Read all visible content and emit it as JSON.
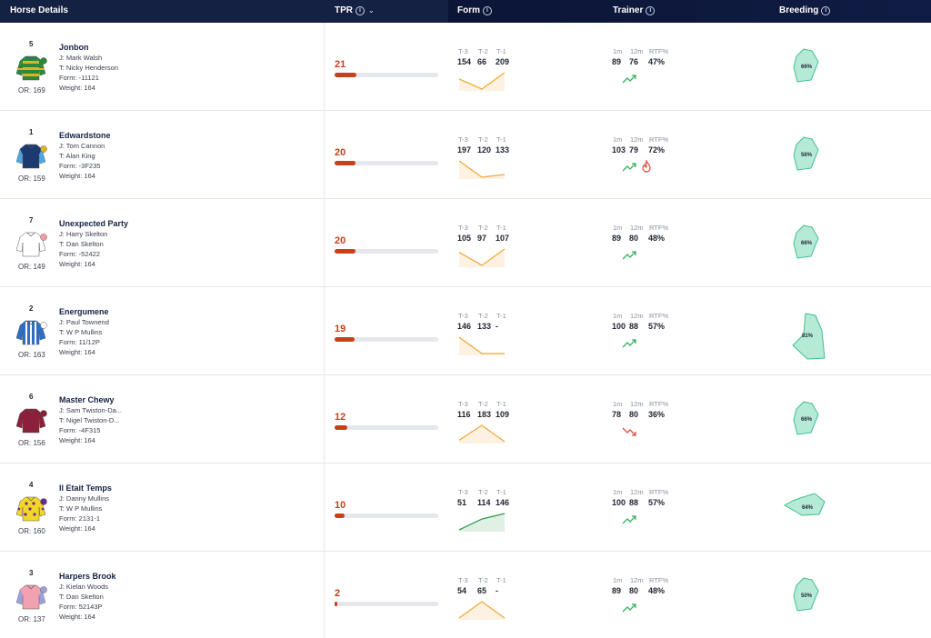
{
  "header": {
    "horse_details": "Horse Details",
    "tpr": "TPR",
    "form": "Form",
    "trainer": "Trainer",
    "breeding": "Breeding",
    "info_icon": "info-icon",
    "sort_icon": "chevron-down-icon"
  },
  "form_labels": [
    "T-3",
    "T-2",
    "T-1"
  ],
  "trainer_labels": [
    "1m",
    "12m",
    "RTF%"
  ],
  "colors": {
    "header_bg": "#142143",
    "tpr_accent": "#c4411b",
    "spark_orange": "#f2a93b",
    "spark_green": "#2e9b4e",
    "trend_green": "#2eb15b",
    "trend_red": "#e0483a",
    "breeding_fill": "#b5ead6",
    "breeding_stroke": "#3fbf8f"
  },
  "rows": [
    {
      "number": "5",
      "name": "Jonbon",
      "jockey": "J: Mark Walsh",
      "trainer": "T: Nicky Henderson",
      "form": "Form: -11121",
      "or": "OR: 169",
      "weight": "Weight: 164",
      "tpr": "21",
      "tpr_pct": 0.21,
      "form_vals": [
        "154",
        "66",
        "209"
      ],
      "spark": [
        154,
        66,
        209
      ],
      "spark_color": "orange",
      "trainer_vals": [
        "89",
        "76",
        "47%"
      ],
      "trend": "up",
      "hot": false,
      "breeding_pct": "66%",
      "breeding_shape": "small",
      "silk": {
        "body": "#2a8a3c",
        "stripe": "#e0b320",
        "sleeve": "#2a8a3c",
        "cap": "#2a8a3c",
        "pattern": "hoops"
      }
    },
    {
      "number": "1",
      "name": "Edwardstone",
      "jockey": "J: Tom Cannon",
      "trainer": "T: Alan King",
      "form": "Form: -3F235",
      "or": "OR: 159",
      "weight": "Weight: 164",
      "tpr": "20",
      "tpr_pct": 0.2,
      "form_vals": [
        "197",
        "120",
        "133"
      ],
      "spark": [
        197,
        120,
        133
      ],
      "spark_color": "orange",
      "trainer_vals": [
        "103",
        "79",
        "72%"
      ],
      "trend": "up",
      "hot": true,
      "breeding_pct": "56%",
      "breeding_shape": "small",
      "silk": {
        "body": "#1c3a70",
        "stripe": "#1c3a70",
        "sleeve": "#4fa6dc",
        "cap": "#e0b320",
        "pattern": "plain"
      }
    },
    {
      "number": "7",
      "name": "Unexpected Party",
      "jockey": "J: Harry Skelton",
      "trainer": "T: Dan Skelton",
      "form": "Form: -52422",
      "or": "OR: 149",
      "weight": "Weight: 164",
      "tpr": "20",
      "tpr_pct": 0.2,
      "form_vals": [
        "105",
        "97",
        "107"
      ],
      "spark": [
        105,
        97,
        107
      ],
      "spark_color": "orange",
      "trainer_vals": [
        "89",
        "80",
        "48%"
      ],
      "trend": "up",
      "hot": false,
      "breeding_pct": "66%",
      "breeding_shape": "small",
      "silk": {
        "body": "#ffffff",
        "stripe": "#ffffff",
        "sleeve": "#ffffff",
        "cap": "#f0a0a8",
        "pattern": "plain"
      }
    },
    {
      "number": "2",
      "name": "Energumene",
      "jockey": "J: Paul Townend",
      "trainer": "T: W P Mullins",
      "form": "Form: 11/12P",
      "or": "OR: 163",
      "weight": "Weight: 164",
      "tpr": "19",
      "tpr_pct": 0.19,
      "form_vals": [
        "146",
        "133",
        "-"
      ],
      "spark": [
        146,
        133,
        null
      ],
      "spark_color": "orange",
      "trainer_vals": [
        "100",
        "88",
        "57%"
      ],
      "trend": "up",
      "hot": false,
      "breeding_pct": "81%",
      "breeding_shape": "large",
      "silk": {
        "body": "#2e6fc4",
        "stripe": "#ffffff",
        "sleeve": "#2e6fc4",
        "cap": "#ffffff",
        "pattern": "stripes"
      }
    },
    {
      "number": "6",
      "name": "Master Chewy",
      "jockey": "J: Sam Twiston-Da...",
      "trainer": "T: Nigel Twiston-D...",
      "form": "Form: -4F315",
      "or": "OR: 156",
      "weight": "Weight: 164",
      "tpr": "12",
      "tpr_pct": 0.12,
      "form_vals": [
        "116",
        "183",
        "109"
      ],
      "spark": [
        116,
        183,
        109
      ],
      "spark_color": "orange",
      "trainer_vals": [
        "78",
        "80",
        "36%"
      ],
      "trend": "down",
      "hot": false,
      "breeding_pct": "66%",
      "breeding_shape": "small",
      "silk": {
        "body": "#8c1f3a",
        "stripe": "#8c1f3a",
        "sleeve": "#8c1f3a",
        "cap": "#8c1f3a",
        "pattern": "plain"
      }
    },
    {
      "number": "4",
      "name": "Il Etait Temps",
      "jockey": "J: Danny Mullins",
      "trainer": "T: W P Mullins",
      "form": "Form: 2131-1",
      "or": "OR: 160",
      "weight": "Weight: 164",
      "tpr": "10",
      "tpr_pct": 0.1,
      "form_vals": [
        "51",
        "114",
        "146"
      ],
      "spark": [
        51,
        114,
        146
      ],
      "spark_color": "green",
      "trainer_vals": [
        "100",
        "88",
        "57%"
      ],
      "trend": "up",
      "hot": false,
      "breeding_pct": "64%",
      "breeding_shape": "wide",
      "silk": {
        "body": "#f2d62a",
        "stripe": "#6a2a8a",
        "sleeve": "#f2d62a",
        "cap": "#6a2a8a",
        "pattern": "spots"
      }
    },
    {
      "number": "3",
      "name": "Harpers Brook",
      "jockey": "J: Kielan Woods",
      "trainer": "T: Dan Skelton",
      "form": "Form: 52143P",
      "or": "OR: 137",
      "weight": "Weight: 164",
      "tpr": "2",
      "tpr_pct": 0.02,
      "form_vals": [
        "54",
        "65",
        "-"
      ],
      "spark": [
        54,
        65,
        null
      ],
      "spark_color": "orange",
      "trainer_vals": [
        "89",
        "80",
        "48%"
      ],
      "trend": "up",
      "hot": false,
      "breeding_pct": "50%",
      "breeding_shape": "small",
      "silk": {
        "body": "#f1a1b0",
        "stripe": "#f1a1b0",
        "sleeve": "#9aa0d8",
        "cap": "#9aa0d8",
        "pattern": "plain"
      }
    }
  ]
}
